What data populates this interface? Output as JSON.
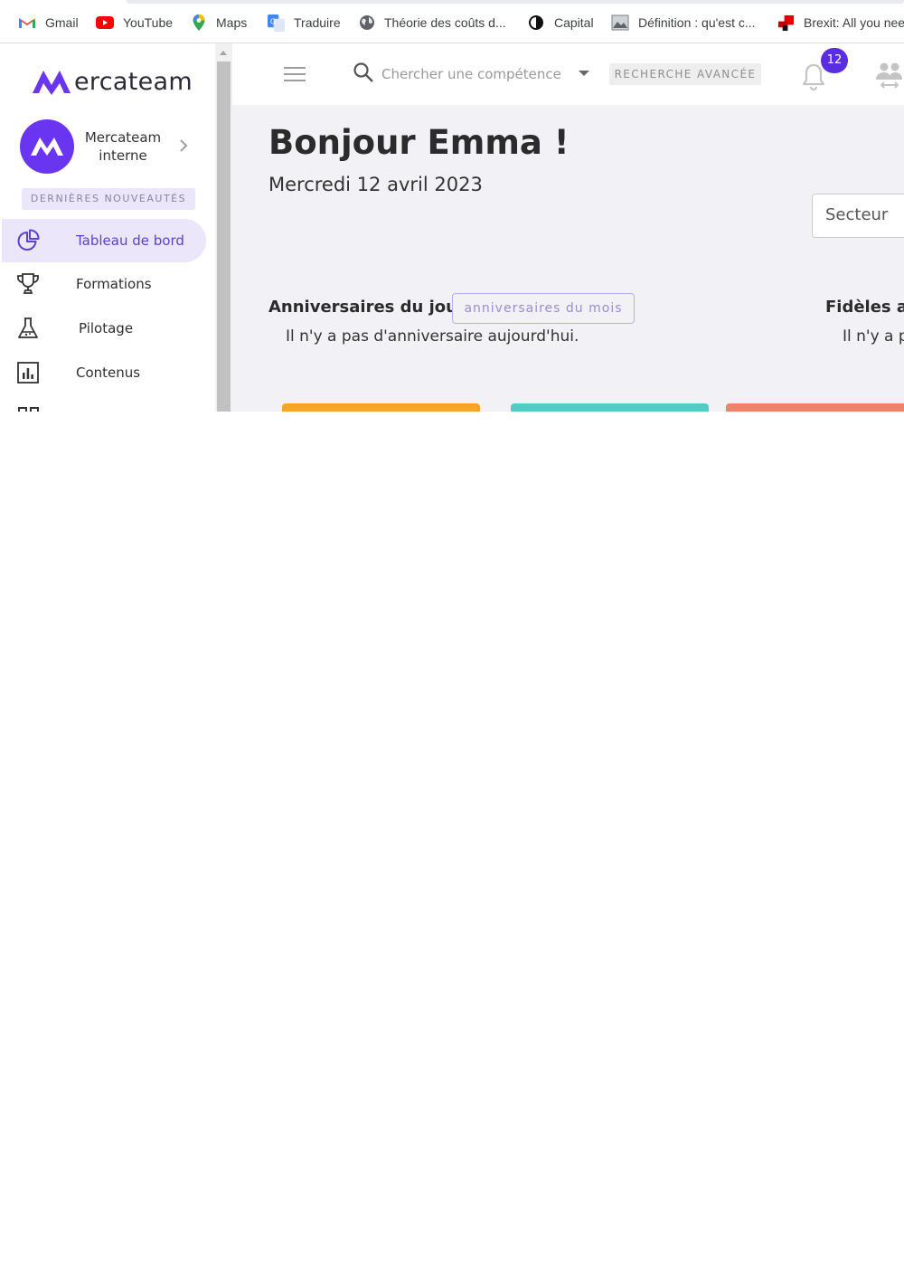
{
  "bookmarks": [
    {
      "label": "Gmail",
      "icon": "gmail-icon"
    },
    {
      "label": "YouTube",
      "icon": "youtube-icon"
    },
    {
      "label": "Maps",
      "icon": "maps-icon"
    },
    {
      "label": "Traduire",
      "icon": "translate-icon"
    },
    {
      "label": "Théorie des coûts d...",
      "icon": "globe-icon"
    },
    {
      "label": "Capital",
      "icon": "capital-icon"
    },
    {
      "label": "Définition : qu'est c...",
      "icon": "image-icon"
    },
    {
      "label": "Brexit: All you nee",
      "icon": "brexit-icon"
    }
  ],
  "sidebar": {
    "logo_text": "ercateam",
    "org_name": "Mercateam interne",
    "news_label": "DERNIÈRES NOUVEAUTÉS",
    "items": [
      {
        "label": "Tableau de bord",
        "icon": "pie-chart-icon",
        "active": true
      },
      {
        "label": "Formations",
        "icon": "trophy-icon"
      },
      {
        "label": "Pilotage",
        "icon": "flask-icon"
      },
      {
        "label": "Contenus",
        "icon": "bar-chart-icon"
      }
    ]
  },
  "appbar": {
    "search_placeholder": "Chercher une compétence, u",
    "advanced_search_label": "RECHERCHE AVANCÉE",
    "notification_count": "12"
  },
  "main": {
    "greeting": "Bonjour Emma !",
    "date": "Mercredi 12 avril 2023",
    "sector_label": "Secteur",
    "birthdays_title": "Anniversaires du jour",
    "birthdays_month_button": "anniversaires du mois",
    "birthdays_empty": "Il n'y a pas d'anniversaire aujourd'hui.",
    "loyal_title": "Fidèles au",
    "loyal_text": "Il n'y a p"
  },
  "colors": {
    "brand": "#6a35f0",
    "card_1": "#f5a623",
    "card_2": "#4ecdc4",
    "card_3": "#f0826a"
  }
}
